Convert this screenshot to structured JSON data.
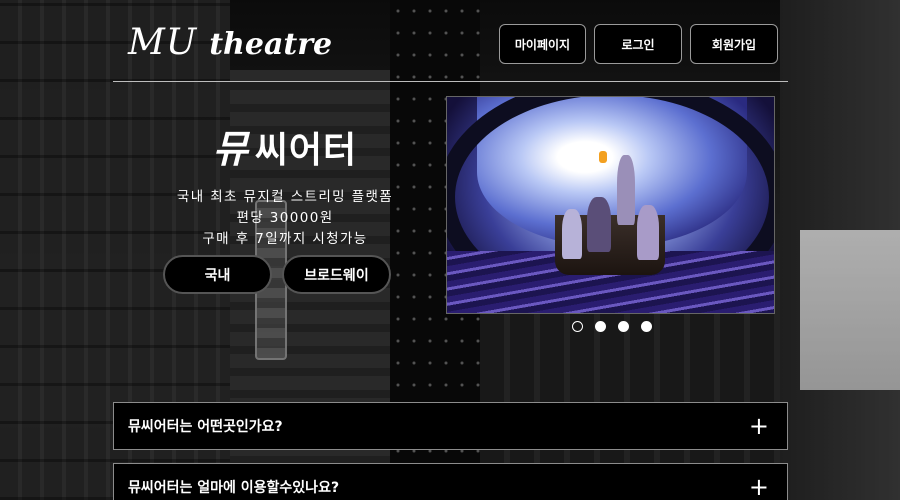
{
  "header": {
    "logo_mu": "MU",
    "logo_theatre": "theatre",
    "nav": [
      "마이페이지",
      "로그인",
      "회원가입"
    ]
  },
  "hero": {
    "title_mu": "뮤",
    "title_rest": "씨어터",
    "lines": [
      "국내 최초 뮤지컬 스트리밍 플랫폼",
      "편당 30000원",
      "구매 후 7일까지 시청가능"
    ],
    "buttons": [
      "국내",
      "브로드웨이"
    ]
  },
  "carousel": {
    "slide_count": 4,
    "active_index": 0
  },
  "faq": [
    {
      "question": "뮤씨어터는 어떤곳인가요?",
      "icon": "plus-icon"
    },
    {
      "question": "뮤씨어터는 얼마에 이용할수있나요?",
      "icon": "plus-icon"
    }
  ],
  "colors": {
    "button_bg": "#000000",
    "text": "#ffffff",
    "border": "#9a9a9a"
  }
}
